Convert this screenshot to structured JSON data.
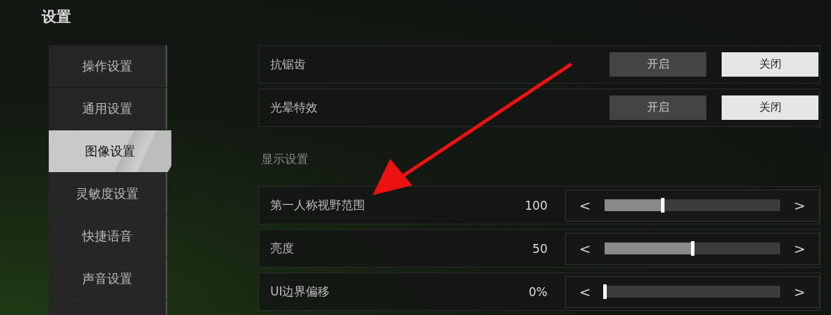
{
  "title": "设置",
  "sidebar": {
    "items": [
      {
        "label": "操作设置",
        "selected": false
      },
      {
        "label": "通用设置",
        "selected": false
      },
      {
        "label": "图像设置",
        "selected": true
      },
      {
        "label": "灵敏度设置",
        "selected": false
      },
      {
        "label": "快捷语音",
        "selected": false
      },
      {
        "label": "声音设置",
        "selected": false
      }
    ]
  },
  "toggles": [
    {
      "label": "抗锯齿",
      "options": [
        {
          "label": "开启",
          "selected": false
        },
        {
          "label": "关闭",
          "selected": true
        }
      ]
    },
    {
      "label": "光晕特效",
      "options": [
        {
          "label": "开启",
          "selected": false
        },
        {
          "label": "关闭",
          "selected": true
        }
      ]
    }
  ],
  "section": "显示设置",
  "sliders": [
    {
      "label": "第一人称视野范围",
      "reading": "100",
      "level": 0.33,
      "prev": "<",
      "next": ">"
    },
    {
      "label": "亮度",
      "reading": "50",
      "level": 0.5,
      "prev": "<",
      "next": ">"
    },
    {
      "label": "UI边界偏移",
      "reading": "0%",
      "level": 0,
      "prev": "<",
      "next": ">"
    }
  ]
}
